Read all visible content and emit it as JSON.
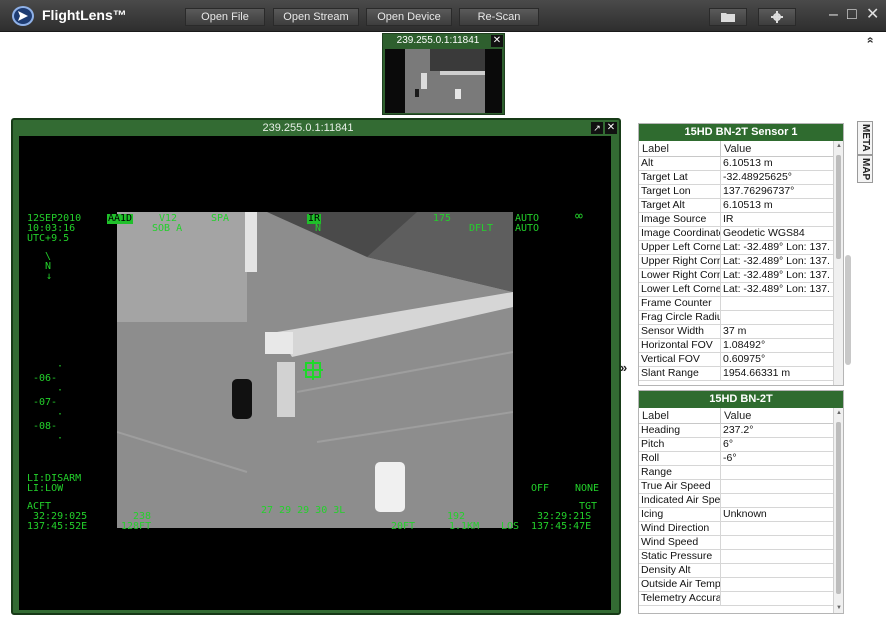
{
  "app": {
    "title": "FlightLens™",
    "toolbar": {
      "open_file": "Open File",
      "open_stream": "Open Stream",
      "open_device": "Open Device",
      "rescan": "Re-Scan"
    },
    "icons": {
      "folder": "folder-icon",
      "settings": "gear-icon",
      "minimize": "minimize-icon",
      "maximize": "maximize-icon",
      "close": "close-icon"
    }
  },
  "thumbnail": {
    "title": "239.255.0.1:11841",
    "close": "✕"
  },
  "video": {
    "title": "239.255.0.1:11841",
    "close": "✕",
    "hud": {
      "date": "12SEP2010",
      "time": "10:03:16",
      "utc": "UTC+9.5",
      "mode1": "AA1D",
      "mode2": "V12",
      "mode3": "SOB A",
      "mode4": "SPA",
      "sensor": "IR",
      "sensor_sub": "N",
      "az": "175",
      "dflt": "DFLT",
      "auto1": "AUTO",
      "auto2": "AUTO",
      "inf": "∞",
      "north_top": "\\",
      "north_n": "N",
      "scale": [
        "-06-",
        "-07-",
        "-08-"
      ],
      "li_disarm": "LI:DISARM",
      "li_low": "LI:LOW",
      "off": "OFF",
      "none": "NONE",
      "acft": "ACFT",
      "acft_lat": "32:29:025",
      "acft_lon": "137:45:52E",
      "alt1": "238",
      "alt2": "128FT",
      "center_coord": "27 29 29 30 3L",
      "range1": "192",
      "range2": "1.1KM",
      "los": "LOS",
      "hdg": "20FT",
      "tgt": "TGT",
      "tgt_lat": "32:29:21S",
      "tgt_lon": "137:45:47E"
    }
  },
  "panels": {
    "sensor": {
      "title": "15HD BN-2T Sensor 1",
      "col_label": "Label",
      "col_value": "Value",
      "rows": [
        {
          "label": "Alt",
          "value": "6.10513 m"
        },
        {
          "label": "Target Lat",
          "value": "-32.48925625°"
        },
        {
          "label": "Target Lon",
          "value": "137.76296737°"
        },
        {
          "label": "Target Alt",
          "value": "6.10513 m"
        },
        {
          "label": "Image Source",
          "value": "IR"
        },
        {
          "label": "Image Coordinate",
          "value": "Geodetic WGS84"
        },
        {
          "label": "Upper Left Corner",
          "value": "Lat: -32.489° Lon: 137."
        },
        {
          "label": "Upper Right Corn",
          "value": "Lat: -32.489° Lon: 137."
        },
        {
          "label": "Lower Right Corn",
          "value": "Lat: -32.489° Lon: 137."
        },
        {
          "label": "Lower Left Corner",
          "value": "Lat: -32.489° Lon: 137."
        },
        {
          "label": "Frame Counter",
          "value": ""
        },
        {
          "label": "Frag Circle Radius",
          "value": ""
        },
        {
          "label": "Sensor Width",
          "value": "37 m"
        },
        {
          "label": "Horizontal FOV",
          "value": "1.08492°"
        },
        {
          "label": "Vertical FOV",
          "value": "0.60975°"
        },
        {
          "label": "Slant Range",
          "value": "1954.66331 m"
        }
      ]
    },
    "platform": {
      "title": "15HD BN-2T",
      "col_label": "Label",
      "col_value": "Value",
      "rows": [
        {
          "label": "Heading",
          "value": "237.2°"
        },
        {
          "label": "Pitch",
          "value": "6°"
        },
        {
          "label": "Roll",
          "value": "-6°"
        },
        {
          "label": "Range",
          "value": ""
        },
        {
          "label": "True Air Speed",
          "value": ""
        },
        {
          "label": "Indicated Air Speed",
          "value": ""
        },
        {
          "label": "Icing",
          "value": "Unknown"
        },
        {
          "label": "Wind Direction",
          "value": ""
        },
        {
          "label": "Wind Speed",
          "value": ""
        },
        {
          "label": "Static Pressure",
          "value": ""
        },
        {
          "label": "Density Alt",
          "value": ""
        },
        {
          "label": "Outside Air Temp",
          "value": ""
        },
        {
          "label": "Telemetry Accuracy",
          "value": ""
        }
      ]
    }
  },
  "side_tabs": {
    "meta": "META",
    "map": "MAP"
  },
  "collapse_top": "»",
  "collapse_right": "»"
}
